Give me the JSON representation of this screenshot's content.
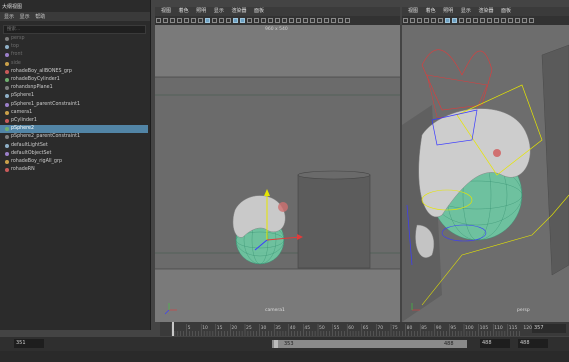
{
  "outliner": {
    "title": "大纲视图",
    "menu": [
      "显示",
      "显示",
      "帮助"
    ],
    "search_placeholder": "搜索...",
    "items": [
      {
        "label": "persp",
        "dim": true
      },
      {
        "label": "top",
        "dim": true
      },
      {
        "label": "front",
        "dim": true
      },
      {
        "label": "side",
        "dim": true
      },
      {
        "label": "rohadeBoy_allBONES_grp",
        "dim": false
      },
      {
        "label": "rohadeBoyCylinder1",
        "dim": false
      },
      {
        "label": "rohandsnpPlane1",
        "dim": false
      },
      {
        "label": "pSphere1",
        "dim": false
      },
      {
        "label": "pSphere1_parentConstraint1",
        "dim": false
      },
      {
        "label": "camera1",
        "dim": false
      },
      {
        "label": "pCylinder1",
        "dim": false
      },
      {
        "label": "pSphere2",
        "dim": false,
        "selected": true
      },
      {
        "label": "pSphere2_parentConstraint1",
        "dim": false
      },
      {
        "label": "defaultLightSet",
        "dim": false
      },
      {
        "label": "defaultObjectSet",
        "dim": false
      },
      {
        "label": "rohadeBoy_rigAll_grp",
        "dim": false
      },
      {
        "label": "rohadeRN",
        "dim": false
      }
    ]
  },
  "viewport_left": {
    "menu": [
      "视图",
      "着色",
      "照明",
      "显示",
      "渲染器",
      "面板"
    ],
    "resolution": "960 x 540",
    "camera_label": "camera1"
  },
  "viewport_right": {
    "menu": [
      "视图",
      "着色",
      "照明",
      "显示",
      "渲染器",
      "面板"
    ],
    "camera_label": "persp"
  },
  "timeline": {
    "ticks": [
      "5",
      "10",
      "15",
      "20",
      "25",
      "30",
      "35",
      "40",
      "45",
      "50",
      "55",
      "60",
      "65",
      "70",
      "75",
      "80",
      "85",
      "90",
      "95",
      "100",
      "105",
      "110",
      "115",
      "120"
    ],
    "current_frame": "357"
  },
  "range": {
    "start_field": "351",
    "inner_start": "353",
    "inner_end": "488",
    "end_field": "488",
    "max_field": "488"
  },
  "colors": {
    "selection": "#5285a6",
    "viewport_bg": "#6b6b6b",
    "rig_red": "#e23a3a",
    "rig_yellow": "#e6e600",
    "rig_blue": "#3a3aff",
    "sphere_green": "#6fd0a8"
  }
}
